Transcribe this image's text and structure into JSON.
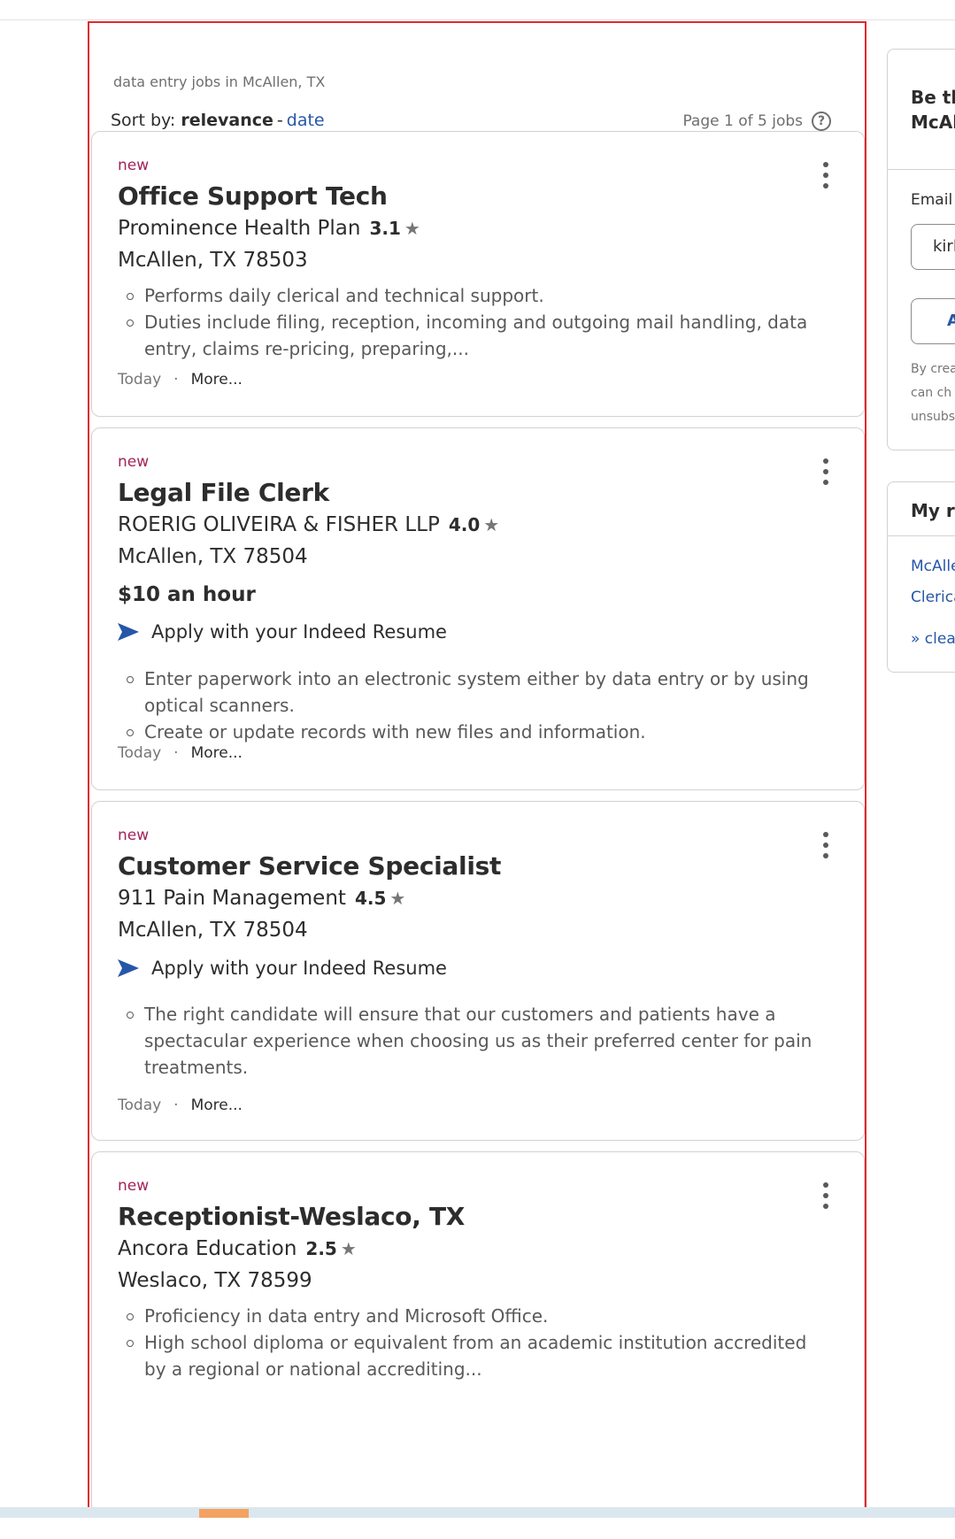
{
  "search": {
    "query_location": "data entry jobs in McAllen, TX",
    "sort_label": "Sort by:",
    "sort_active": "relevance",
    "sort_separator": "-",
    "sort_alt": "date",
    "page_info": "Page 1 of 5 jobs",
    "help_glyph": "?"
  },
  "jobs": [
    {
      "badge": "new",
      "title": "Office Support Tech",
      "company": "Prominence Health Plan",
      "rating": "3.1",
      "location": "McAllen, TX 78503",
      "bullets": [
        "Performs daily clerical and technical support.",
        "Duties include filing, reception, incoming and outgoing mail handling, data entry, claims re-pricing, preparing,..."
      ],
      "posted": "Today",
      "more": "More..."
    },
    {
      "badge": "new",
      "title": "Legal File Clerk",
      "company": "ROERIG OLIVEIRA & FISHER LLP",
      "rating": "4.0",
      "location": "McAllen, TX 78504",
      "salary": "$10 an hour",
      "apply": "Apply with your Indeed Resume",
      "bullets": [
        "Enter paperwork into an electronic system either by data entry or by using optical scanners.",
        "Create or update records with new files and information."
      ],
      "posted": "Today",
      "more": "More..."
    },
    {
      "badge": "new",
      "title": "Customer Service Specialist",
      "company": "911 Pain Management",
      "rating": "4.5",
      "location": "McAllen, TX 78504",
      "apply": "Apply with your Indeed Resume",
      "bullets": [
        "The right candidate will ensure that our customers and patients have a spectacular experience when choosing us as their preferred center for pain treatments."
      ],
      "posted": "Today",
      "more": "More..."
    },
    {
      "badge": "new",
      "title": "Receptionist-Weslaco, TX",
      "company": "Ancora Education",
      "rating": "2.5",
      "location": "Weslaco, TX 78599",
      "bullets": [
        "Proficiency in data entry and Microsoft Office.",
        "High school diploma or equivalent from an academic institution accredited by a regional or national accrediting..."
      ]
    }
  ],
  "sidebar": {
    "alert_title_line1": "Be th",
    "alert_title_line2": "McAll",
    "email_label": "Email",
    "email_value": "kirl",
    "button_label": "A",
    "fine_print": [
      "By crea",
      "can ch",
      "unsubs"
    ],
    "recent_title": "My rec",
    "recent_links": [
      "McAlle",
      "Clerica",
      "» clear"
    ]
  },
  "colors": {
    "accent_blue": "#2557a7",
    "new_badge": "#a3245b",
    "frame_red": "#e0282e"
  }
}
